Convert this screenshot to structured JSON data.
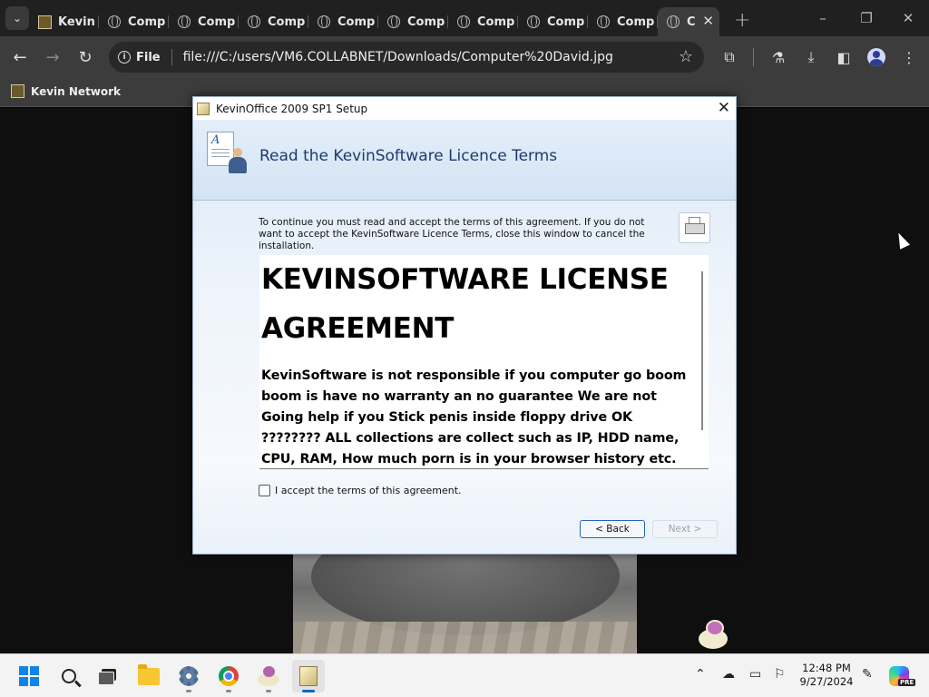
{
  "browser": {
    "tabs": [
      {
        "label": "Kevin",
        "icon": "kevin-network-favicon"
      },
      {
        "label": "Comp",
        "icon": "globe-icon"
      },
      {
        "label": "Comp",
        "icon": "globe-icon"
      },
      {
        "label": "Comp",
        "icon": "globe-icon"
      },
      {
        "label": "Comp",
        "icon": "globe-icon"
      },
      {
        "label": "Comp",
        "icon": "globe-icon"
      },
      {
        "label": "Comp",
        "icon": "globe-icon"
      },
      {
        "label": "Comp",
        "icon": "globe-icon"
      },
      {
        "label": "Comp",
        "icon": "globe-icon"
      },
      {
        "label": "C",
        "icon": "globe-icon",
        "active": true
      }
    ],
    "new_tab": "+",
    "window_controls": {
      "minimize": "–",
      "maximize": "❐",
      "close": "✕"
    },
    "address": {
      "scheme_label": "File",
      "url": "file:///C:/users/VM6.COLLABNET/Downloads/Computer%20David.jpg"
    },
    "bookmark": {
      "label": "Kevin Network"
    }
  },
  "dialog": {
    "title": "KevinOffice 2009 SP1 Setup",
    "close_glyph": "✕",
    "header_title": "Read the KevinSoftware Licence Terms",
    "intro": "To continue you must read and accept the terms of this agreement. If you do not want to accept the KevinSoftware Licence Terms, close this window to cancel the installation.",
    "license_heading": "KEVINSOFTWARE LICENSE AGREEMENT",
    "license_body": "KevinSoftware is not responsible if you computer go boom boom is have no warranty an no guarantee We are not Going help if you Stick penis inside floppy drive OK ???????? ALL collections are collect such as IP, HDD name, CPU, RAM, How much porn is in your browser history etc. ALSO REMEMBERS: NO RESELL OR BANNED",
    "accept_label": "I accept the terms of this agreement.",
    "accept_checked": false,
    "back_label": "< Back",
    "next_label": "Next >",
    "next_enabled": false
  },
  "taskbar": {
    "apps": [
      "start-button",
      "search",
      "task-view",
      "file-explorer",
      "settings",
      "chrome",
      "sheep-app",
      "kevinoffice-setup"
    ],
    "clock": {
      "time": "12:48 PM",
      "date": "9/27/2024"
    },
    "copilot_badge": "PRE"
  },
  "colors": {
    "accent": "#0067c0",
    "dialog_header_text": "#1e3a6e",
    "back_button_border": "#2a64b8"
  }
}
